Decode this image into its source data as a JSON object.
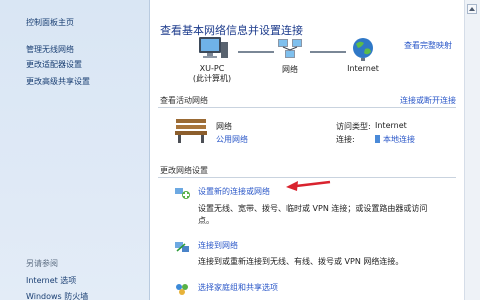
{
  "sidebar": {
    "home": "控制面板主页",
    "items": [
      "管理无线网络",
      "更改适配器设置",
      "更改高级共享设置"
    ],
    "see_also_title": "另请参阅",
    "see_also_items": [
      "Internet 选项",
      "Windows 防火墙"
    ]
  },
  "main": {
    "title": "查看基本网络信息并设置连接",
    "full_map_link": "查看完整映射",
    "nodes": [
      {
        "label1": "XU-PC",
        "label2": "(此计算机)"
      },
      {
        "label1": "网络",
        "label2": ""
      },
      {
        "label1": "Internet",
        "label2": ""
      }
    ],
    "active_section": {
      "title": "查看活动网络",
      "action": "连接或断开连接",
      "network_name": "网络",
      "network_type": "公用网络",
      "access_type_label": "访问类型:",
      "access_type_value": "Internet",
      "connection_label": "连接:",
      "connection_value": "本地连接"
    },
    "change_section": {
      "title": "更改网络设置",
      "tasks": [
        {
          "link": "设置新的连接或网络",
          "desc1": "设置无线、宽带、拨号、临时或 VPN 连接；或设置路由器或访问",
          "desc2": "点。"
        },
        {
          "link": "连接到网络",
          "desc1": "连接到或重新连接到无线、有线、拨号或 VPN 网络连接。",
          "desc2": ""
        },
        {
          "link": "选择家庭组和共享选项",
          "desc1": "",
          "desc2": ""
        }
      ]
    },
    "colors": {
      "link": "#2a57c8",
      "title": "#1b3a8b",
      "arrow": "#d9232e"
    }
  }
}
